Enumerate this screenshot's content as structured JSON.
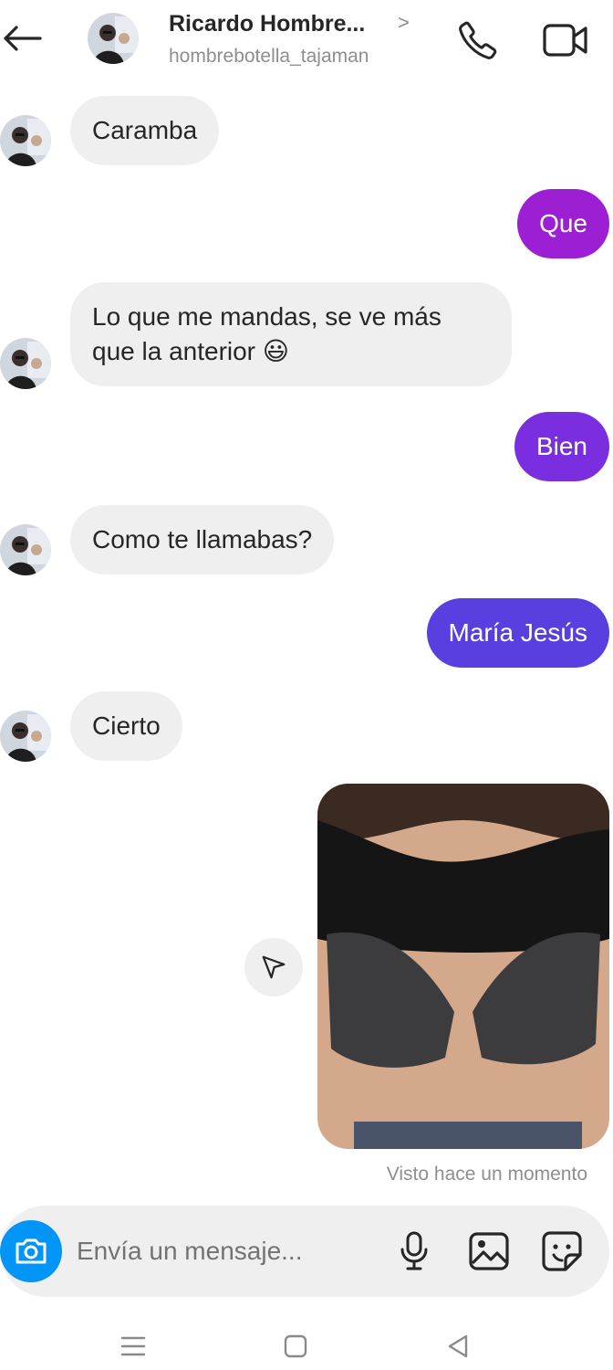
{
  "header": {
    "name": "Ricardo Hombre...",
    "username": "hombrebotella_tajaman",
    "chevron": ">"
  },
  "messages": [
    {
      "direction": "in",
      "text": "Caramba"
    },
    {
      "direction": "out",
      "text": "Que"
    },
    {
      "direction": "in",
      "text": "Lo que me mandas, se ve más que la anterior 😃"
    },
    {
      "direction": "out",
      "text": "Bien"
    },
    {
      "direction": "in",
      "text": "Como te llamabas?"
    },
    {
      "direction": "out",
      "text": "María Jesús"
    },
    {
      "direction": "in",
      "text": "Cierto"
    },
    {
      "direction": "out",
      "type": "photo"
    }
  ],
  "status": {
    "seen": "Visto hace un momento"
  },
  "composer": {
    "placeholder": "Envía un mensaje..."
  },
  "colors": {
    "bubble_in": "#efefef",
    "bubble_out_1": "#9d1fd4",
    "bubble_out_2": "#7a2ee0",
    "bubble_out_3": "#5a3fe0",
    "camera": "#0095f6"
  },
  "icons": [
    "back-arrow-icon",
    "phone-icon",
    "video-camera-icon",
    "send-icon",
    "camera-icon",
    "microphone-icon",
    "gallery-icon",
    "sticker-icon",
    "menu-icon",
    "home-icon",
    "back-triangle-icon"
  ]
}
